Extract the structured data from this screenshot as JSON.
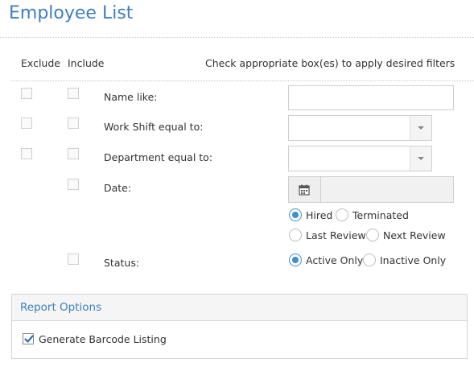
{
  "page": {
    "title": "Employee List"
  },
  "header": {
    "exclude": "Exclude",
    "include": "Include",
    "hint": "Check appropriate box(es) to apply desired filters"
  },
  "filters": {
    "name": {
      "label": "Name like:",
      "value": ""
    },
    "shift": {
      "label": "Work Shift equal to:",
      "value": ""
    },
    "department": {
      "label": "Department equal to:",
      "value": ""
    },
    "date": {
      "label": "Date:",
      "value": "",
      "icon": "calendar-icon"
    },
    "status": {
      "label": "Status:"
    }
  },
  "date_options": {
    "hired": "Hired",
    "terminated": "Terminated",
    "last_review": "Last Review",
    "next_review": "Next Review",
    "selected": "Hired"
  },
  "status_options": {
    "active": "Active Only",
    "inactive": "Inactive Only",
    "selected": "Active Only"
  },
  "report_options": {
    "title": "Report Options",
    "barcode_label": "Generate Barcode Listing",
    "barcode_checked": true
  },
  "colors": {
    "accent": "#3f7fbf",
    "radio": "#3f8ed0",
    "check": "#2f6fb0"
  }
}
